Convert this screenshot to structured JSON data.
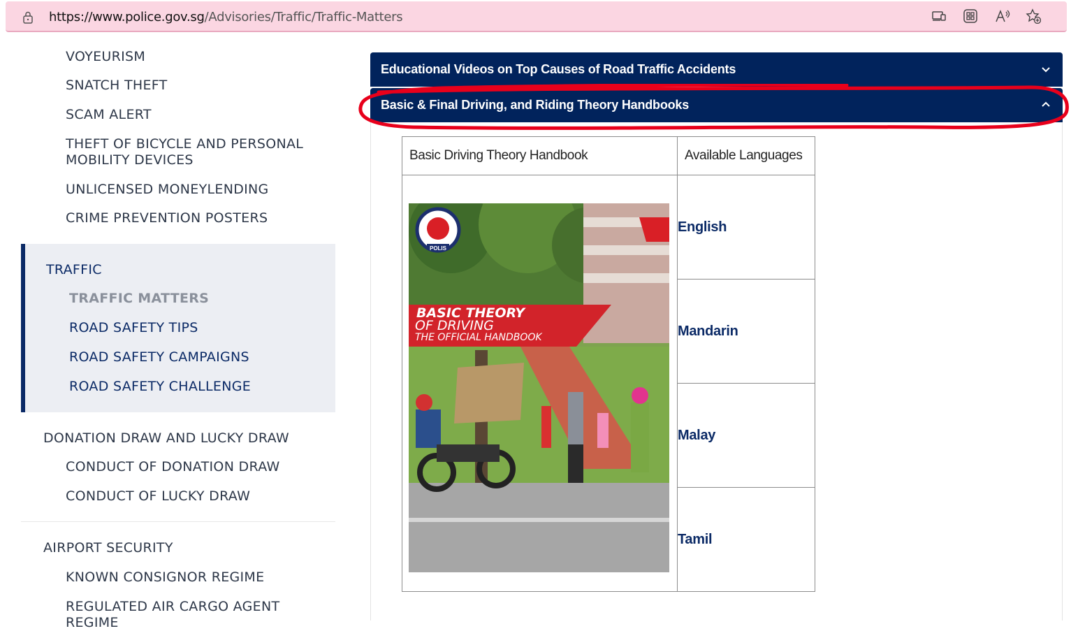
{
  "browser": {
    "url_host": "https://www.police.gov.sg",
    "url_path": "/Advisories/Traffic/Traffic-Matters",
    "icons": [
      "lock-icon",
      "device-icon",
      "apps-icon",
      "read-aloud-icon",
      "favorite-add-icon"
    ]
  },
  "sidebar": {
    "items_top": [
      {
        "label": "VOYEURISM"
      },
      {
        "label": "SNATCH THEFT"
      },
      {
        "label": "SCAM ALERT"
      },
      {
        "label": "THEFT OF BICYCLE AND PERSONAL MOBILITY DEVICES"
      },
      {
        "label": "UNLICENSED MONEYLENDING"
      },
      {
        "label": "CRIME PREVENTION POSTERS"
      }
    ],
    "traffic": {
      "label": "TRAFFIC",
      "children": [
        {
          "label": "TRAFFIC MATTERS",
          "active": true
        },
        {
          "label": "ROAD SAFETY TIPS"
        },
        {
          "label": "ROAD SAFETY CAMPAIGNS"
        },
        {
          "label": "ROAD SAFETY CHALLENGE"
        }
      ]
    },
    "donation": {
      "label": "DONATION DRAW AND LUCKY DRAW",
      "children": [
        {
          "label": "CONDUCT OF DONATION DRAW"
        },
        {
          "label": "CONDUCT OF LUCKY DRAW"
        }
      ]
    },
    "airport": {
      "label": "AIRPORT SECURITY",
      "children": [
        {
          "label": "KNOWN CONSIGNOR REGIME"
        },
        {
          "label": "REGULATED AIR CARGO AGENT REGIME"
        }
      ]
    }
  },
  "main": {
    "accordions": [
      {
        "title": "Educational Videos on Top Causes of Road Traffic Accidents",
        "expanded": false
      },
      {
        "title": "Basic & Final Driving, and Riding Theory Handbooks",
        "expanded": true
      }
    ],
    "table": {
      "headers": [
        "Basic Driving Theory Handbook",
        "Available Languages"
      ],
      "languages": [
        "English",
        "Mandarin",
        "Malay",
        "Tamil"
      ],
      "cover": {
        "line1": "BASIC THEORY",
        "line2": "OF DRIVING",
        "line3": "THE OFFICIAL HANDBOOK",
        "seal_text": "POLIS"
      }
    }
  },
  "colors": {
    "accordion_bg": "#01235c",
    "nav_dark": "#0b2a66",
    "address_bar": "#fbd6e2",
    "highlight": "#e8001b"
  }
}
